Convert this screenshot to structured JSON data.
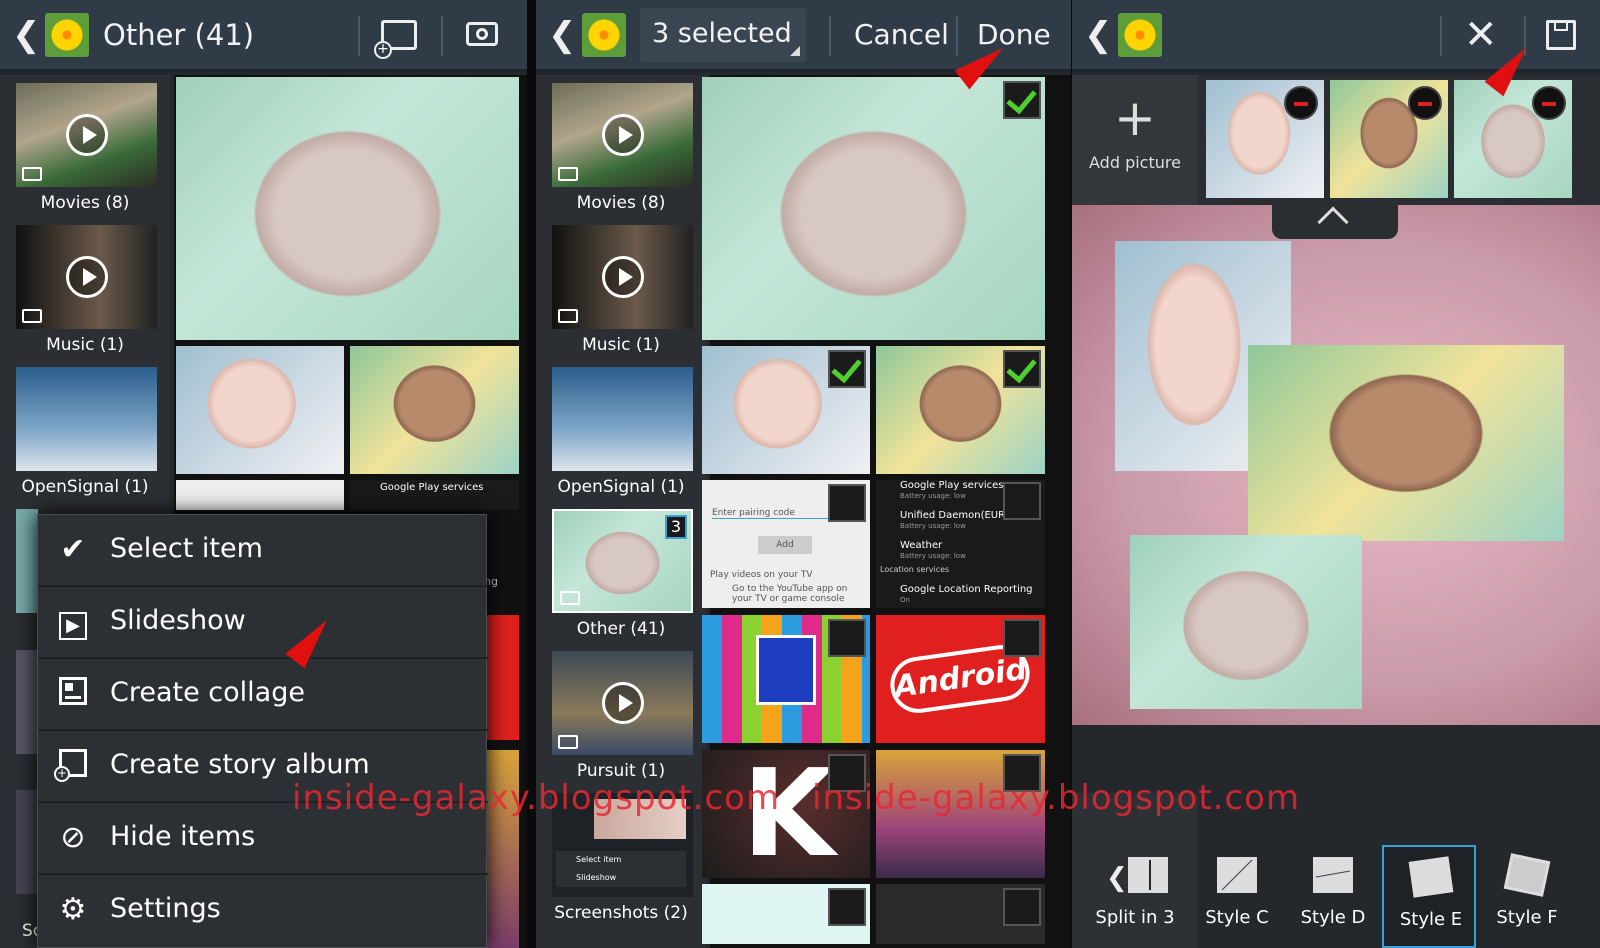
{
  "panel1": {
    "title": "Other (41)",
    "albums": [
      {
        "label": "Movies (8)"
      },
      {
        "label": "Music (1)"
      },
      {
        "label": "OpenSignal (1)"
      }
    ],
    "menu": [
      {
        "label": "Select item",
        "icon": "check-icon"
      },
      {
        "label": "Slideshow",
        "icon": "play-icon"
      },
      {
        "label": "Create collage",
        "icon": "collage-icon"
      },
      {
        "label": "Create story album",
        "icon": "story-album-icon"
      },
      {
        "label": "Hide items",
        "icon": "eye-off-icon"
      },
      {
        "label": "Settings",
        "icon": "gear-icon"
      }
    ],
    "notification": "Google Play services",
    "partial_label": "ng",
    "sc_label": "Sc"
  },
  "panel2": {
    "selected": "3 selected",
    "cancel": "Cancel",
    "done": "Done",
    "albums": [
      {
        "label": "Movies (8)"
      },
      {
        "label": "Music (1)"
      },
      {
        "label": "OpenSignal (1)"
      },
      {
        "label": "Other (41)",
        "badge": "3"
      },
      {
        "label": "Pursuit (1)"
      },
      {
        "label": "Screenshots (2)"
      }
    ],
    "settings_list": [
      {
        "title": "Google Play services",
        "sub": "Battery usage: low"
      },
      {
        "title": "Unified Daemon(EUR)",
        "sub": "Battery usage: low"
      },
      {
        "title": "Weather",
        "sub": "Battery usage: low"
      },
      {
        "title": "Location services",
        "sub": ""
      },
      {
        "title": "Google Location Reporting",
        "sub": "On"
      }
    ],
    "pairing_placeholder": "Enter pairing code",
    "add_button": "Add",
    "play_videos": "Play videos on your TV",
    "youtube_hint": "Go to the YouTube app on your TV or game console",
    "screenshot_menu": [
      "Select item",
      "Slideshow"
    ],
    "android_logo": "Android",
    "k_letter": "K"
  },
  "panel3": {
    "add_picture": "Add picture",
    "styles": [
      {
        "label": "Split in 3"
      },
      {
        "label": "Style C"
      },
      {
        "label": "Style D"
      },
      {
        "label": "Style E",
        "active": true
      },
      {
        "label": "Style F"
      }
    ]
  },
  "watermark": "inside-galaxy.blogspot.com",
  "colors": {
    "topbar": "#2f3b47",
    "accent": "#3aa0d6",
    "check": "#4ed12f",
    "arrow": "#e01010"
  }
}
